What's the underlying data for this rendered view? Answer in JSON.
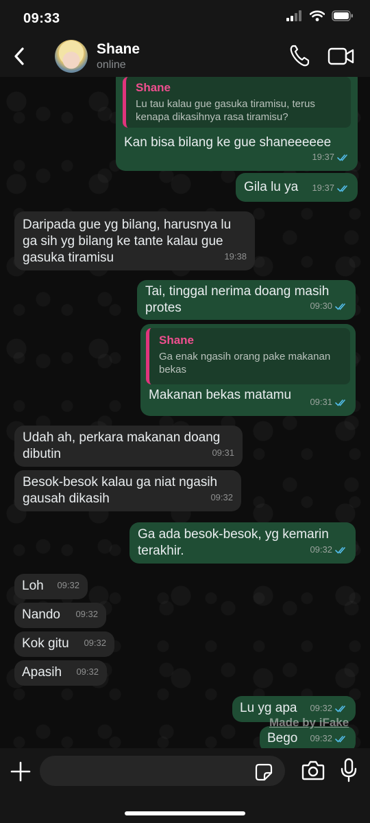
{
  "status_bar": {
    "time": "09:33"
  },
  "header": {
    "name": "Shane",
    "status": "online"
  },
  "messages": [
    {
      "text": "Kan bisa bilang ke gue shaneeeeee",
      "time": "19:37",
      "quote_name": "Shane",
      "quote_text": "Lu tau kalau gue gasuka tiramisu, terus kenapa dikasihnya rasa tiramisu?"
    },
    {
      "text": "Gila lu ya",
      "time": "19:37"
    },
    {
      "text": "Daripada gue yg bilang, harusnya lu ga sih yg bilang ke tante kalau gue gasuka tiramisu",
      "time": "19:38"
    },
    {
      "text": "Tai, tinggal nerima doang masih protes",
      "time": "09:30"
    },
    {
      "text": "Makanan bekas matamu",
      "time": "09:31",
      "quote_name": "Shane",
      "quote_text": "Ga enak ngasih orang pake makanan bekas"
    },
    {
      "text": "Udah ah, perkara makanan doang dibutin",
      "time": "09:31"
    },
    {
      "text": "Besok-besok kalau ga niat ngasih gausah dikasih",
      "time": "09:32"
    },
    {
      "text": "Ga ada besok-besok, yg kemarin terakhir.",
      "time": "09:32"
    },
    {
      "text": "Loh",
      "time": "09:32"
    },
    {
      "text": "Nando",
      "time": "09:32"
    },
    {
      "text": "Kok gitu",
      "time": "09:32"
    },
    {
      "text": "Apasih",
      "time": "09:32"
    },
    {
      "text": "Lu yg apa",
      "time": "09:32"
    },
    {
      "text": "Bego",
      "time": "09:32"
    }
  ],
  "watermark": "Made by iFake",
  "colors": {
    "outgoing": "#1f4d34",
    "incoming": "#262626",
    "quote_accent": "#e0347c",
    "read_ticks": "#53bdeb"
  },
  "icons": [
    "back-chevron-icon",
    "phone-icon",
    "video-camera-icon",
    "plus-icon",
    "sticker-icon",
    "camera-icon",
    "microphone-icon",
    "double-check-icon"
  ]
}
